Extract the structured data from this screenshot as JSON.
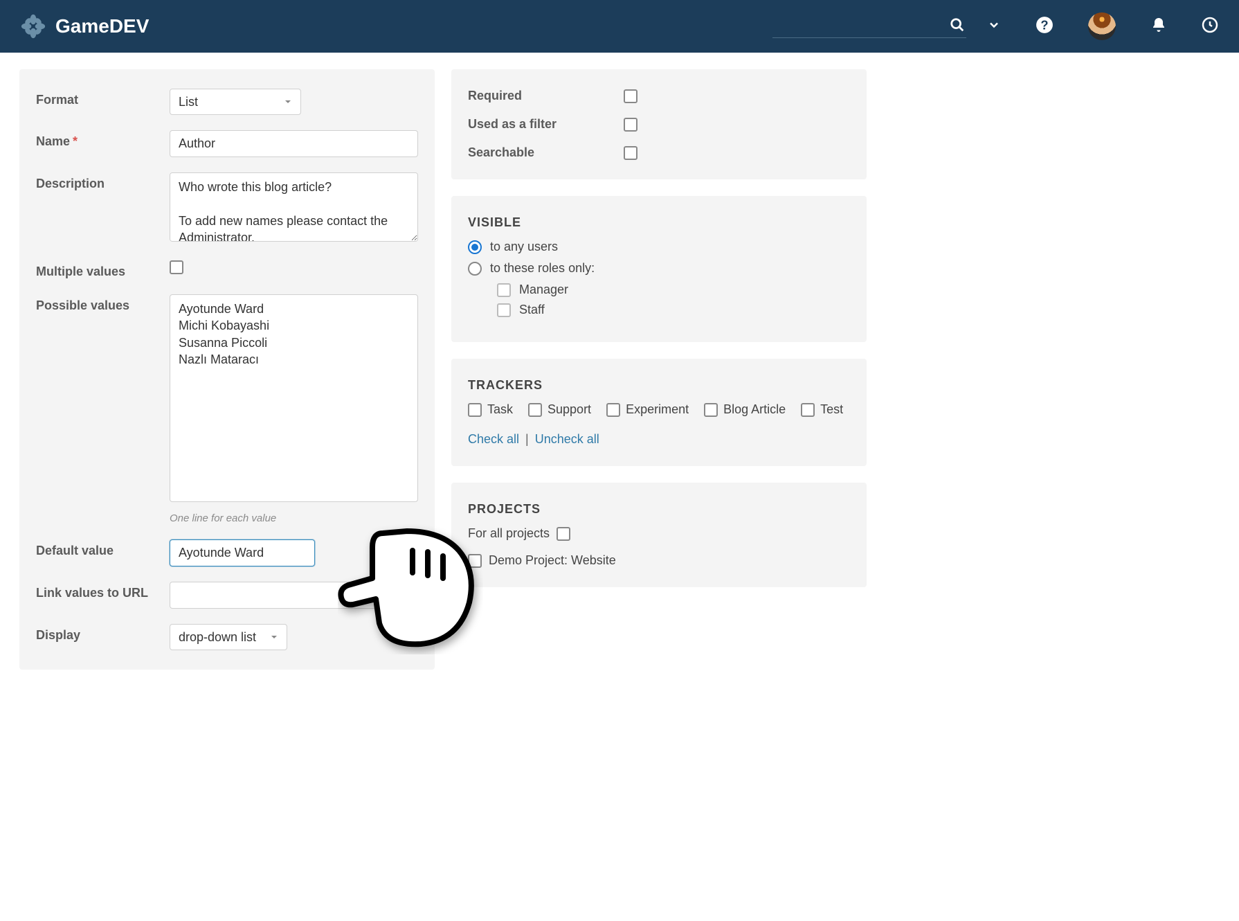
{
  "brand": "GameDEV",
  "left": {
    "format_label": "Format",
    "format_value": "List",
    "name_label": "Name",
    "name_value": "Author",
    "description_label": "Description",
    "description_value": "Who wrote this blog article?\n\nTo add new names please contact the Administrator.",
    "multiple_label": "Multiple values",
    "possible_label": "Possible values",
    "possible_values": "Ayotunde Ward\nMichi Kobayashi\nSusanna Piccoli\nNazlı Mataracı",
    "possible_hint": "One line for each value",
    "default_label": "Default value",
    "default_value": "Ayotunde Ward",
    "link_label": "Link values to URL",
    "link_value": "",
    "display_label": "Display",
    "display_value": "drop-down list"
  },
  "right_options": {
    "required": "Required",
    "filter": "Used as a filter",
    "searchable": "Searchable"
  },
  "visible": {
    "title": "Visible",
    "any": "to any users",
    "roles": "to these roles only:",
    "role_manager": "Manager",
    "role_staff": "Staff"
  },
  "trackers": {
    "title": "Trackers",
    "items": [
      "Task",
      "Support",
      "Experiment",
      "Blog Article",
      "Test"
    ],
    "check_all": "Check all",
    "uncheck_all": "Uncheck all"
  },
  "projects": {
    "title": "Projects",
    "for_all": "For all projects",
    "item0": "Demo Project: Website"
  }
}
